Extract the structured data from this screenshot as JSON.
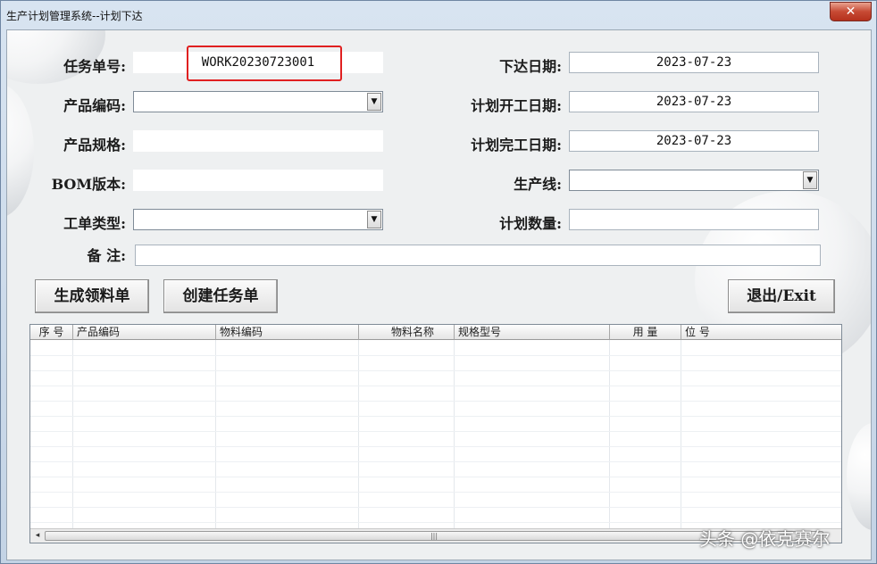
{
  "window": {
    "title": "生产计划管理系统--计划下达",
    "close_label": "✕"
  },
  "form": {
    "task_no": {
      "label": "任务单号:",
      "value": "WORK20230723001"
    },
    "issue_date": {
      "label": "下达日期:",
      "value": "2023-07-23"
    },
    "product_code": {
      "label": "产品编码:",
      "value": ""
    },
    "plan_start_date": {
      "label": "计划开工日期:",
      "value": "2023-07-23"
    },
    "product_spec": {
      "label": "产品规格:",
      "value": ""
    },
    "plan_end_date": {
      "label": "计划完工日期:",
      "value": "2023-07-23"
    },
    "bom_version": {
      "label": "BOM版本:",
      "value": ""
    },
    "production_line": {
      "label": "生产线:",
      "value": ""
    },
    "work_order_type": {
      "label": "工单类型:",
      "value": ""
    },
    "plan_quantity": {
      "label": "计划数量:",
      "value": ""
    },
    "remark": {
      "label": "备 注:",
      "value": ""
    }
  },
  "buttons": {
    "generate_pick_list": "生成领料单",
    "create_task": "创建任务单",
    "exit": "退出/Exit"
  },
  "grid": {
    "columns": [
      "序 号",
      "产品编码",
      "物料编码",
      "物料名称",
      "规格型号",
      "用 量",
      "位 号"
    ],
    "rows": []
  },
  "scroll": {
    "left_arrow": "◂",
    "thumb_grip": "|||"
  },
  "watermark": "头条 @依克赛尔",
  "colors": {
    "highlight": "#e02020",
    "close_button": "#c74a34"
  }
}
